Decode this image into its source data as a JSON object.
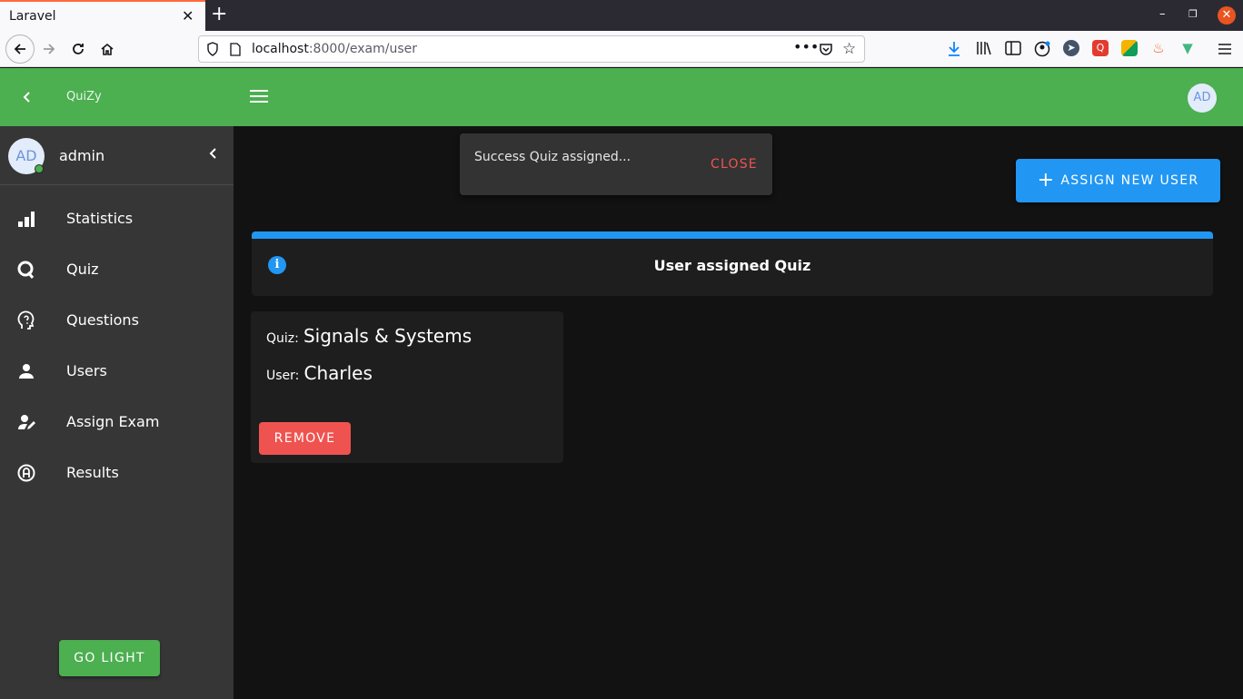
{
  "browser": {
    "tab_title": "Laravel",
    "url_host": "localhost",
    "url_path": ":8000/exam/user"
  },
  "appbar": {
    "brand": "QuiZy",
    "avatar_initials": "AD"
  },
  "sidebar": {
    "profile": {
      "initials": "AD",
      "name": "admin"
    },
    "items": [
      {
        "label": "Statistics",
        "icon": "bar-chart-icon"
      },
      {
        "label": "Quiz",
        "icon": "quiz-q-icon"
      },
      {
        "label": "Questions",
        "icon": "head-question-icon"
      },
      {
        "label": "Users",
        "icon": "user-icon"
      },
      {
        "label": "Assign Exam",
        "icon": "user-edit-icon"
      },
      {
        "label": "Results",
        "icon": "grade-circle-icon"
      }
    ],
    "theme_button": "GO LIGHT"
  },
  "snackbar": {
    "message": "Success Quiz assigned...",
    "close_label": "CLOSE"
  },
  "main": {
    "assign_button": "ASSIGN NEW USER",
    "alert_title": "User assigned Quiz",
    "card": {
      "quiz_key": "Quiz:",
      "quiz_value": "Signals & Systems",
      "user_key": "User:",
      "user_value": "Charles",
      "remove_label": "REMOVE"
    }
  },
  "colors": {
    "appbar": "#4caf50",
    "primary": "#2196f3",
    "danger": "#ef5350",
    "sidebar": "#363636",
    "background": "#121212"
  }
}
